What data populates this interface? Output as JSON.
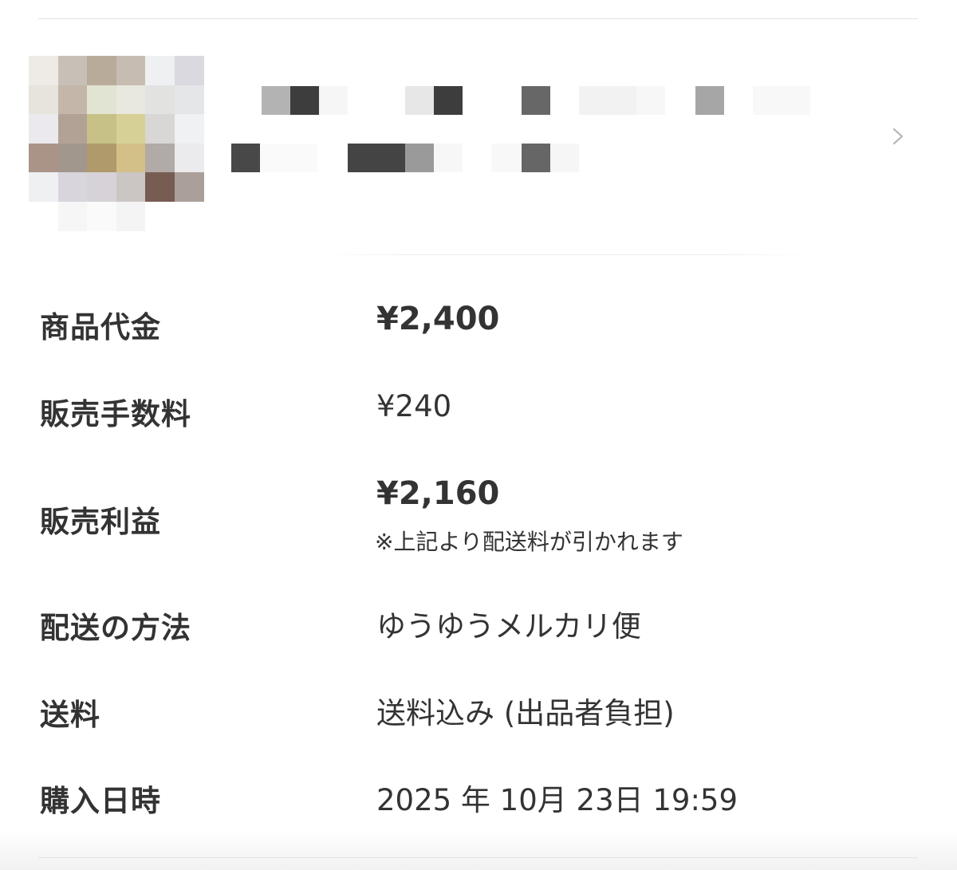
{
  "details": {
    "price": {
      "label": "商品代金",
      "value": "¥2,400"
    },
    "fee": {
      "label": "販売手数料",
      "value": "¥240"
    },
    "profit": {
      "label": "販売利益",
      "value": "¥2,160",
      "note": "※上記より配送料が引かれます"
    },
    "shipping_method": {
      "label": "配送の方法",
      "value": "ゆうゆうメルカリ便"
    },
    "shipping_fee": {
      "label": "送料",
      "value": "送料込み (出品者負担)"
    },
    "purchase_date": {
      "label": "購入日時",
      "value": "2025 年 10月 23日 19:59"
    }
  },
  "icons": {
    "item_chevron": "chevron-right-icon"
  },
  "colors": {
    "text": "#333333",
    "divider": "#e2e2e2",
    "chevron": "#b8b8b8"
  }
}
